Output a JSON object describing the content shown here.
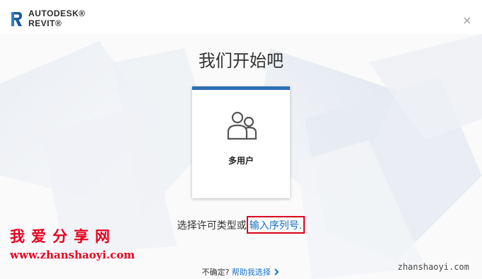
{
  "header": {
    "brand_top": "AUTODESK®",
    "brand_bottom": "REVIT®",
    "close_label": "×"
  },
  "main": {
    "title": "我们开始吧",
    "license_card": {
      "label": "多用户",
      "icon": "multi-user-icon"
    },
    "select_prefix": "选择许可类型或",
    "serial_link": "输入序列号",
    "select_suffix": "."
  },
  "footer": {
    "question": "不确定?",
    "help_link": "帮助我选择",
    "chevron_icon": "chevron-right-icon"
  },
  "watermark": {
    "cn_text": "我爱分享网",
    "url_left": "www.zhanshaoyi.com",
    "url_right": "zhanshaoyi.com"
  },
  "colors": {
    "accent_blue": "#2d6eb3",
    "link_blue": "#1a73c8",
    "highlight_red": "#d9001b",
    "watermark_red": "#e8001f"
  }
}
